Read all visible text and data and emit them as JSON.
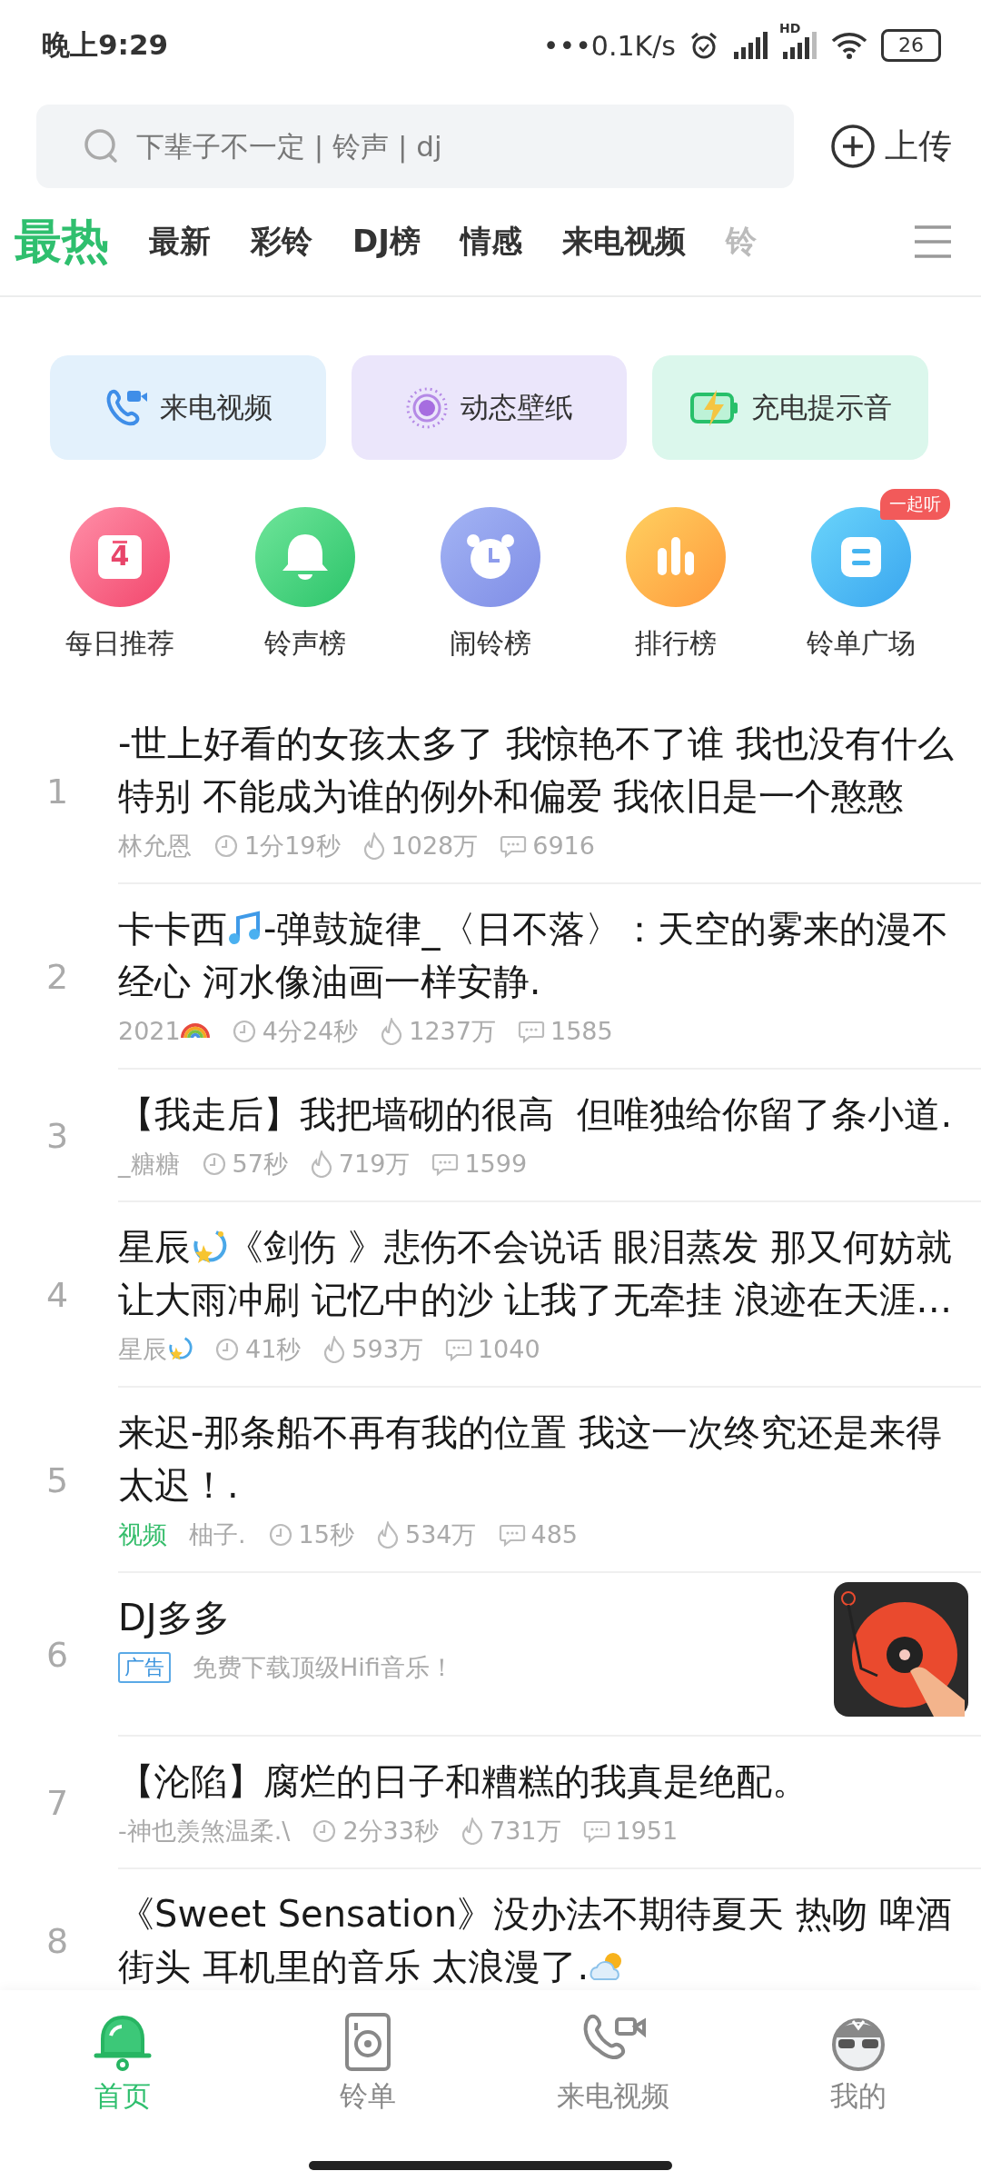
{
  "status_bar": {
    "time": "晚上9:29",
    "net_speed": "•••0.1K/s",
    "network_label": "HD",
    "battery": "26"
  },
  "search": {
    "placeholder": "下辈子不一定 | 铃声 | dj"
  },
  "upload_label": "上传",
  "tabs": [
    {
      "label": "最热",
      "selected": true
    },
    {
      "label": "最新",
      "selected": false
    },
    {
      "label": "彩铃",
      "selected": false
    },
    {
      "label": "DJ榜",
      "selected": false
    },
    {
      "label": "情感",
      "selected": false
    },
    {
      "label": "来电视频",
      "selected": false
    },
    {
      "label": "铃",
      "selected": false
    }
  ],
  "shortcuts": [
    {
      "label": "来电视频"
    },
    {
      "label": "动态壁纸"
    },
    {
      "label": "充电提示音"
    }
  ],
  "categories": [
    {
      "label": "每日推荐",
      "calendar_day": "4"
    },
    {
      "label": "铃声榜"
    },
    {
      "label": "闹铃榜"
    },
    {
      "label": "排行榜"
    },
    {
      "label": "铃单广场",
      "badge": "一起听"
    }
  ],
  "songs": [
    {
      "kind": "song",
      "rank": "1",
      "title": [
        {
          "kind": "text",
          "text": "-世上好看的女孩太多了 我惊艳不了谁 我也没有什么特别 不能成为谁的例外和偏爱 我依旧是一个憨憨"
        }
      ],
      "author": [
        {
          "kind": "text",
          "text": "林允恩"
        }
      ],
      "duration": "1分19秒",
      "plays": "1028万",
      "comments": "6916"
    },
    {
      "kind": "song",
      "rank": "2",
      "title": [
        {
          "kind": "text",
          "text": "卡卡西"
        },
        {
          "kind": "notes"
        },
        {
          "kind": "text",
          "text": "-弹鼓旋律_〈日不落〉：天空的雾来的漫不经心 河水像油画一样安静."
        }
      ],
      "author": [
        {
          "kind": "text",
          "text": "2021"
        },
        {
          "kind": "rainbow"
        }
      ],
      "duration": "4分24秒",
      "plays": "1237万",
      "comments": "1585"
    },
    {
      "kind": "song",
      "rank": "3",
      "title": [
        {
          "kind": "text",
          "text": "【我走后】我把墙砌的很高  但唯独给你留了条小道."
        }
      ],
      "author": [
        {
          "kind": "text",
          "text": "_糖糖"
        }
      ],
      "duration": "57秒",
      "plays": "719万",
      "comments": "1599"
    },
    {
      "kind": "song",
      "rank": "4",
      "title": [
        {
          "kind": "text",
          "text": "星辰"
        },
        {
          "kind": "sparkle"
        },
        {
          "kind": "text",
          "text": "《剑伤 》悲伤不会说话 眼泪蒸发 那又何妨就让大雨冲刷 记忆中的沙 让我了无牵挂 浪迹在天涯…"
        }
      ],
      "author": [
        {
          "kind": "text",
          "text": "星辰"
        },
        {
          "kind": "sparkle"
        }
      ],
      "duration": "41秒",
      "plays": "593万",
      "comments": "1040"
    },
    {
      "kind": "song",
      "rank": "5",
      "title": [
        {
          "kind": "text",
          "text": "来迟-那条船不再有我的位置 我这一次终究还是来得太迟！."
        }
      ],
      "tag": "视频",
      "author": [
        {
          "kind": "text",
          "text": "柚子."
        }
      ],
      "duration": "15秒",
      "plays": "534万",
      "comments": "485"
    },
    {
      "kind": "ad",
      "rank": "6",
      "title": [
        {
          "kind": "text",
          "text": "DJ多多"
        }
      ],
      "tag": "广告",
      "description": "免费下载顶级Hifi音乐！"
    },
    {
      "kind": "song",
      "rank": "7",
      "title": [
        {
          "kind": "text",
          "text": "【沦陷】腐烂的日子和糟糕的我真是绝配。"
        }
      ],
      "author": [
        {
          "kind": "text",
          "text": "-神也羡煞温柔.\\"
        }
      ],
      "duration": "2分33秒",
      "plays": "731万",
      "comments": "1951"
    },
    {
      "kind": "song",
      "rank": "8",
      "title": [
        {
          "kind": "text",
          "text": "《Sweet Sensation》没办法不期待夏天 热吻 啤酒街头 耳机里的音乐 太浪漫了."
        },
        {
          "kind": "cloud"
        }
      ]
    }
  ],
  "nav": [
    {
      "label": "首页",
      "selected": true
    },
    {
      "label": "铃单",
      "selected": false
    },
    {
      "label": "来电视频",
      "selected": false
    },
    {
      "label": "我的",
      "selected": false
    }
  ]
}
